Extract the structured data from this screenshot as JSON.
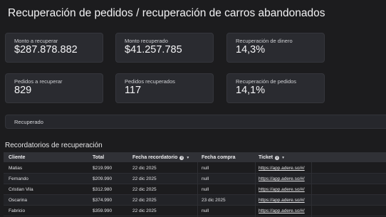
{
  "page": {
    "title": "Recuperación de pedidos / recuperación de carros abandonados"
  },
  "cards": [
    {
      "label": "Monto a recuperar",
      "value": "$287.878.882"
    },
    {
      "label": "Monto recuperado",
      "value": "$41.257.785"
    },
    {
      "label": "Recuperación de dinero",
      "value": "14,3%"
    },
    {
      "label": "Pedidos a recuperar",
      "value": "829"
    },
    {
      "label": "Pedidos recuperados",
      "value": "117"
    },
    {
      "label": "Recuperación de pedidos",
      "value": "14,1%"
    }
  ],
  "filter_bar": {
    "label": "Recuperado"
  },
  "reminders": {
    "title": "Recordatorios de recuperación",
    "columns": [
      "Cliente",
      "Total",
      "Fecha recordatorio",
      "Fecha compra",
      "Ticket"
    ],
    "rows": [
      [
        "Matias",
        "$219.990",
        "22 dic 2025",
        "null",
        "https://app.adere.so/#/"
      ],
      [
        "Fernando",
        "$209.990",
        "22 dic 2025",
        "null",
        "https://app.adere.so/#/"
      ],
      [
        "Cristian Vila",
        "$312.980",
        "22 dic 2025",
        "null",
        "https://app.adere.so/#/"
      ],
      [
        "Oscarina",
        "$374.990",
        "22 dic 2025",
        "23 dic 2025",
        "https://app.adere.so/#/"
      ],
      [
        "Fabricio",
        "$359.990",
        "22 dic 2025",
        "null",
        "https://app.adere.so/#/"
      ]
    ]
  },
  "colors": {
    "background": "#1c1c1e",
    "card": "#2a2b30",
    "table_header": "#303136"
  },
  "icons": {
    "info": "info-icon",
    "sort": "sort-down-icon"
  }
}
